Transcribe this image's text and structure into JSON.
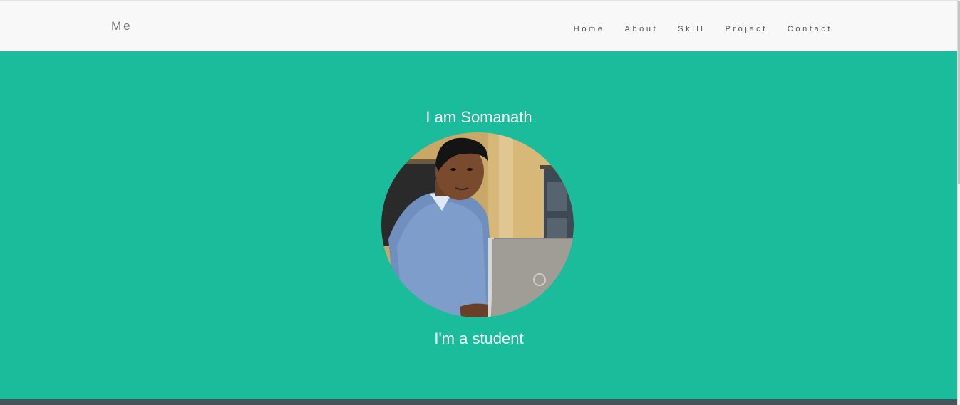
{
  "navbar": {
    "brand": "Me",
    "links": [
      "Home",
      "About",
      "Skill",
      "Project",
      "Contact"
    ]
  },
  "hero": {
    "title": "I am Somanath",
    "subtitle": "I'm a student",
    "background": "#1bbc9b",
    "avatar_alt": "profile photo"
  },
  "colors": {
    "navbar_bg": "#f8f8f8",
    "accent": "#1bbc9b",
    "footer": "#4a525c"
  }
}
